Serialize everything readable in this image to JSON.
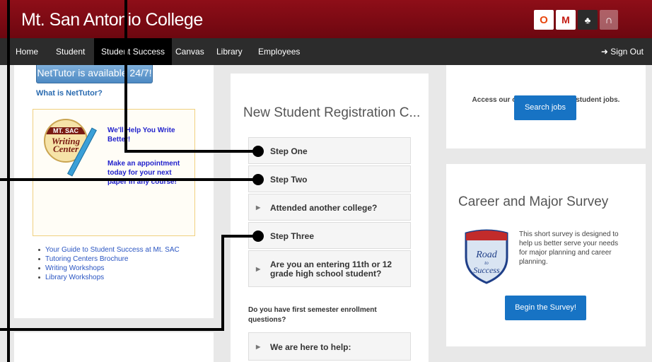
{
  "header": {
    "site_title": "Mt. San Antonio College",
    "icons": [
      "office-icon",
      "gmail-icon",
      "sitemap-icon",
      "apps-icon"
    ],
    "office_glyph": "O",
    "gmail_glyph": "M",
    "sitemap_glyph": "♣",
    "apps_glyph": "∩"
  },
  "nav": {
    "items": [
      "Home",
      "Student",
      "Student Success",
      "Canvas",
      "Library",
      "Employees"
    ],
    "active": "Student Success",
    "signout": "Sign Out"
  },
  "left": {
    "nettutor_button": "NetTutor is available 24/7!",
    "nettutor_link": "What is NetTutor?",
    "writing_center": {
      "logo_top": "MT. SAC",
      "logo_main": "Writing Center",
      "text1": "We'll Help You Write Better!",
      "text2": "Make an appointment today for your next paper in any course!"
    },
    "links": [
      "Your Guide to Student Success at Mt. SAC",
      "Tutoring Centers Brochure",
      "Writing Workshops",
      "Library Workshops"
    ]
  },
  "middle": {
    "title": "New Student Registration C...",
    "steps": [
      "Step One",
      "Step Two",
      "Attended another college?",
      "Step Three",
      "Are you an entering 11th or 12 grade high school student?"
    ],
    "question": "Do you have first semester enrollment questions?",
    "help": "We are here to help:"
  },
  "right": {
    "access_text": "Access our online directory of student jobs.",
    "search_jobs": "Search jobs",
    "career_title": "Career and Major Survey",
    "survey_text": "This short survey is designed to help us better serve your needs for major planning and career planning.",
    "road_logo": "Road to Success",
    "begin_survey": "Begin the Survey!"
  },
  "colors": {
    "header": "#7a0a14",
    "nav": "#2c2c2c",
    "accent_blue": "#1773c4"
  }
}
